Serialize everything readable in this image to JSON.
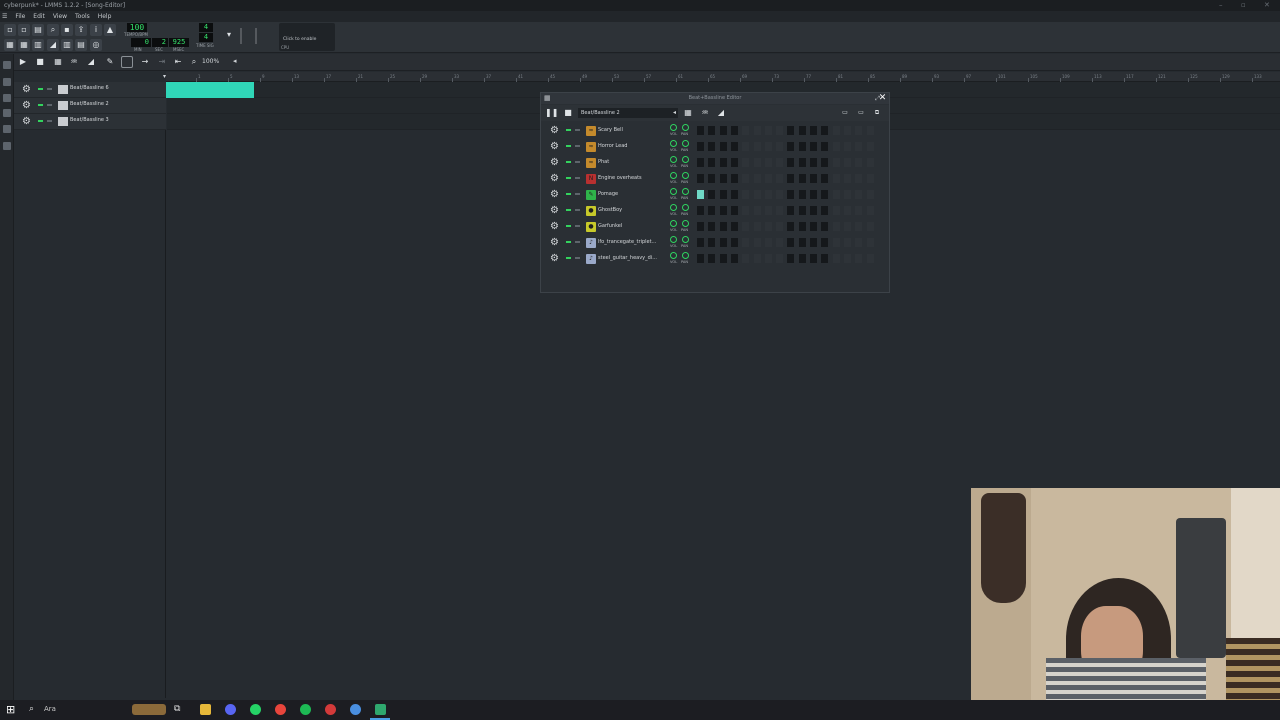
{
  "window": {
    "title": "cyberpunk* - LMMS 1.2.2 - [Song-Editor]"
  },
  "menu": {
    "items": [
      "File",
      "Edit",
      "View",
      "Tools",
      "Help"
    ]
  },
  "toolbar": {
    "tempo_value": "100",
    "tempo_label": "TEMPO/BPM",
    "time_min": "0",
    "time_sec": "2",
    "time_msec": "925",
    "min_label": "MIN",
    "sec_label": "SEC",
    "msec_label": "MSEC",
    "timesig_num": "4",
    "timesig_den": "4",
    "timesig_label": "TIME SIG",
    "cpu_text": "Click to enable",
    "cpu_label": "CPU"
  },
  "song_editor": {
    "zoom": "100%",
    "timeline_ticks": [
      "1",
      "5",
      "9",
      "13",
      "17",
      "21",
      "25",
      "29",
      "33",
      "37",
      "41",
      "45",
      "49",
      "53",
      "57",
      "61",
      "65",
      "69",
      "73",
      "77",
      "81",
      "85",
      "89",
      "93",
      "97",
      "101",
      "105",
      "109",
      "113",
      "117",
      "121",
      "125",
      "129",
      "133",
      "137"
    ],
    "tracks": [
      {
        "name": "Beat/Bassline 6"
      },
      {
        "name": "Beat/Bassline 2"
      },
      {
        "name": "Beat/Bassline 3"
      }
    ],
    "pattern_color": "#30d6b8"
  },
  "bb_editor": {
    "title": "Beat+Bassline Editor",
    "selected": "Beat/Bassline 2",
    "close_glyph": "✕",
    "vol_label": "VOL",
    "pan_label": "PAN",
    "instruments": [
      {
        "name": "Scary Bell",
        "icon": "tripleoscillator-icon",
        "color": "#c48a2c",
        "glyph": "≈"
      },
      {
        "name": "Horror Lead",
        "icon": "tripleoscillator-icon",
        "color": "#c48a2c",
        "glyph": "≈"
      },
      {
        "name": "Phat",
        "icon": "tripleoscillator-icon",
        "color": "#c48a2c",
        "glyph": "≈"
      },
      {
        "name": "Engine overheats",
        "icon": "nes-icon",
        "color": "#b83030",
        "glyph": "N"
      },
      {
        "name": "Pomage",
        "icon": "sfxr-icon",
        "color": "#2fb44a",
        "glyph": "✎"
      },
      {
        "name": "GhostBoy",
        "icon": "organic-icon",
        "color": "#c7c92a",
        "glyph": "●"
      },
      {
        "name": "Garfunkel",
        "icon": "organic-icon",
        "color": "#c7c92a",
        "glyph": "●"
      },
      {
        "name": "lfo_trancegate_triplet...",
        "icon": "audiofile-processor-icon",
        "color": "#9aa9c9",
        "glyph": "♪"
      },
      {
        "name": "steel_guitar_heavy_di...",
        "icon": "audiofile-processor-icon",
        "color": "#9aa9c9",
        "glyph": "♪"
      }
    ],
    "active_step": {
      "row": 4,
      "step": 0
    }
  },
  "taskbar": {
    "search_text": "Ara"
  },
  "colors": {
    "accent": "#30d6b8",
    "led": "#33d35e",
    "lcd": "#35e26b"
  }
}
